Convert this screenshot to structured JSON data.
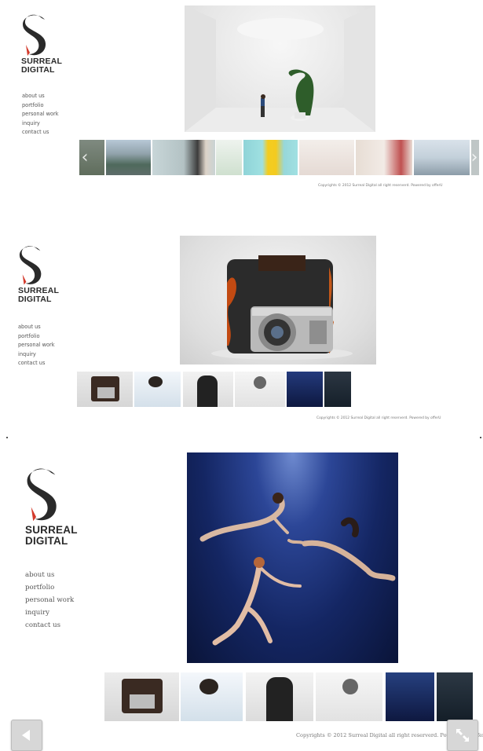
{
  "brand": {
    "line1": "SURREAL",
    "line2": "DIGITAL"
  },
  "nav": [
    "about us",
    "portfolio",
    "personal work",
    "inquiry",
    "contact us"
  ],
  "copyright": "Copyrights © 2012 Surreal Digital all right reserverd. Powered by offerU",
  "copyright_large": "Copyrights © 2012 Surreal Digital all right reserverd. Powered by offerU",
  "panel1_thumbs": [
    "building",
    "portrait-woman",
    "product-phone",
    "woman-camera-yellow",
    "woman-room",
    "woman-sofa",
    "city-harbor"
  ],
  "panel2_thumbs": [
    "camera-fire",
    "woman-camera-white",
    "man-camera",
    "woman-camera-bw",
    "underwater",
    "dark-figure"
  ],
  "panel3_thumbs": [
    "camera-fire",
    "woman-camera-white",
    "man-camera",
    "woman-camera-bw",
    "underwater",
    "dark-figure"
  ],
  "icons": {
    "prev": "left-arrow-icon",
    "fullscreen": "collapse-icon"
  },
  "colors": {
    "accent": "#d33a2c",
    "logo": "#2a2a2a"
  }
}
